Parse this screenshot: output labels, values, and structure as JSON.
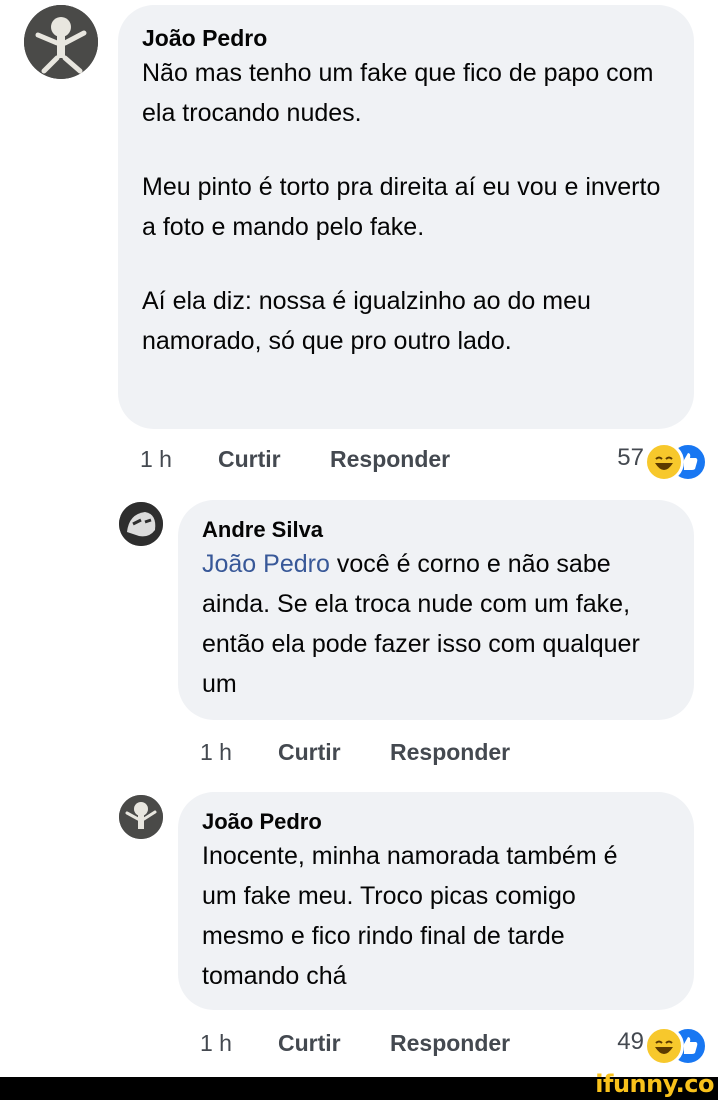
{
  "comments": [
    {
      "author": "João Pedro",
      "paragraphs": [
        "Não mas tenho um fake que fico de papo com ela trocando nudes.",
        "Meu pinto é torto pra direita aí eu vou e inverto a foto e mando pelo fake.",
        "Aí ela diz: nossa é igualzinho ao do meu namorado, só que pro outro lado."
      ],
      "time": "1 h",
      "like_label": "Curtir",
      "reply_label": "Responder",
      "reaction_count": "57"
    },
    {
      "author": "Andre Silva",
      "mention": "João Pedro",
      "text_after_mention": " você é corno e não sabe ainda. Se ela troca nude com um fake, então ela pode fazer isso com qualquer um",
      "time": "1 h",
      "like_label": "Curtir",
      "reply_label": "Responder"
    },
    {
      "author": "João Pedro",
      "text": "Inocente, minha namorada também é um fake meu. Troco picas comigo mesmo e fico rindo final de tarde tomando chá",
      "time": "1 h",
      "like_label": "Curtir",
      "reply_label": "Responder",
      "reaction_count": "49"
    }
  ],
  "reactions": [
    "haha-emoji-icon",
    "like-thumb-icon"
  ],
  "watermark": "ifunny.co",
  "colors": {
    "bubble": "#f0f2f5",
    "mention": "#385898",
    "meta": "#444950",
    "haha": "#f7c82c",
    "like": "#1877f2",
    "watermark": "#f9c11b"
  }
}
